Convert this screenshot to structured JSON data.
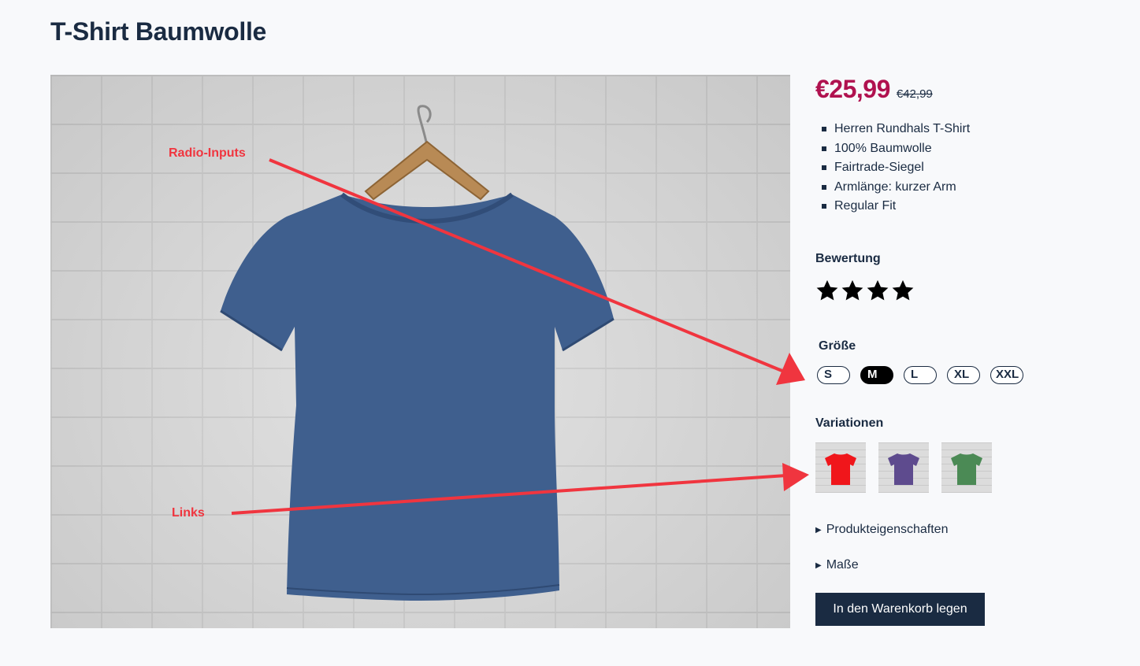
{
  "product": {
    "title": "T-Shirt Baumwolle",
    "price": "€25,99",
    "old_price": "€42,99",
    "features": [
      "Herren Rundhals T-Shirt",
      "100% Baumwolle",
      "Fairtrade-Siegel",
      "Armlänge: kurzer Arm",
      "Regular Fit"
    ],
    "image_shirt_color": "#3f5f8e"
  },
  "rating": {
    "label": "Bewertung",
    "stars": 4,
    "max_stars": 4
  },
  "size": {
    "label": "Größe",
    "options": [
      "S",
      "M",
      "L",
      "XL",
      "XXL"
    ],
    "selected": "M"
  },
  "variations": {
    "label": "Variationen",
    "colors": [
      "#f0161b",
      "#5e4b8e",
      "#4b8a55"
    ]
  },
  "details": {
    "properties": "Produkteigenschaften",
    "dimensions": "Maße"
  },
  "cart": {
    "button_label": "In den Warenkorb legen"
  },
  "annotations": {
    "radio_inputs": "Radio-Inputs",
    "links": "Links",
    "arrow_color": "#f0353f"
  }
}
